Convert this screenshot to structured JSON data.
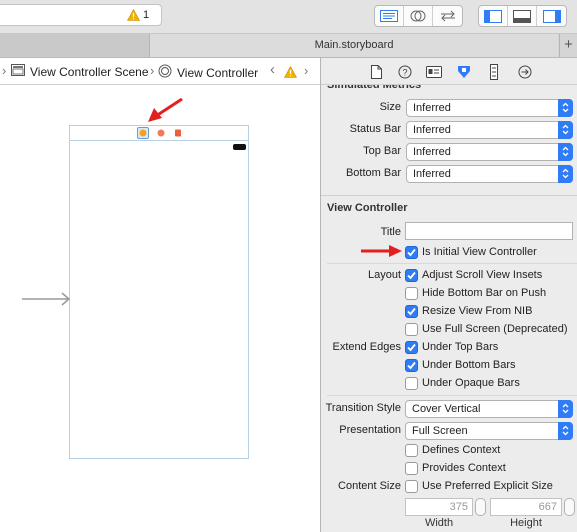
{
  "toolbar": {
    "activity_warning_count": "1"
  },
  "tabbar": {
    "active_tab": "Main.storyboard",
    "add_tab": "+"
  },
  "breadcrumb": {
    "items": [
      "View Controller Scene",
      "View Controller"
    ],
    "chevron_left": "‹",
    "chevron_sep": "›"
  },
  "inspector": {
    "simulated_metrics": {
      "title": "Simulated Metrics",
      "rows": [
        {
          "label": "Size",
          "value": "Inferred"
        },
        {
          "label": "Status Bar",
          "value": "Inferred"
        },
        {
          "label": "Top Bar",
          "value": "Inferred"
        },
        {
          "label": "Bottom Bar",
          "value": "Inferred"
        }
      ]
    },
    "view_controller": {
      "title": "View Controller",
      "title_label": "Title",
      "title_value": "",
      "initial_label": "Is Initial View Controller",
      "layout_label": "Layout",
      "layout_options": [
        {
          "label": "Adjust Scroll View Insets",
          "checked": true
        },
        {
          "label": "Hide Bottom Bar on Push",
          "checked": false
        },
        {
          "label": "Resize View From NIB",
          "checked": true
        },
        {
          "label": "Use Full Screen (Deprecated)",
          "checked": false
        }
      ],
      "extend_edges_label": "Extend Edges",
      "extend_edges_options": [
        {
          "label": "Under Top Bars",
          "checked": true
        },
        {
          "label": "Under Bottom Bars",
          "checked": true
        },
        {
          "label": "Under Opaque Bars",
          "checked": false
        }
      ],
      "transition_style_label": "Transition Style",
      "transition_style_value": "Cover Vertical",
      "presentation_label": "Presentation",
      "presentation_value": "Full Screen",
      "context_options": [
        {
          "label": "Defines Context",
          "checked": false
        },
        {
          "label": "Provides Context",
          "checked": false
        }
      ],
      "content_size_label": "Content Size",
      "content_size_option": {
        "label": "Use Preferred Explicit Size",
        "checked": false
      },
      "width_value": "375",
      "height_value": "667",
      "width_label": "Width",
      "height_label": "Height"
    }
  },
  "colors": {
    "accent": "#2f7cf6",
    "annotation_arrow": "#e32020",
    "warning": "#f2b300"
  }
}
